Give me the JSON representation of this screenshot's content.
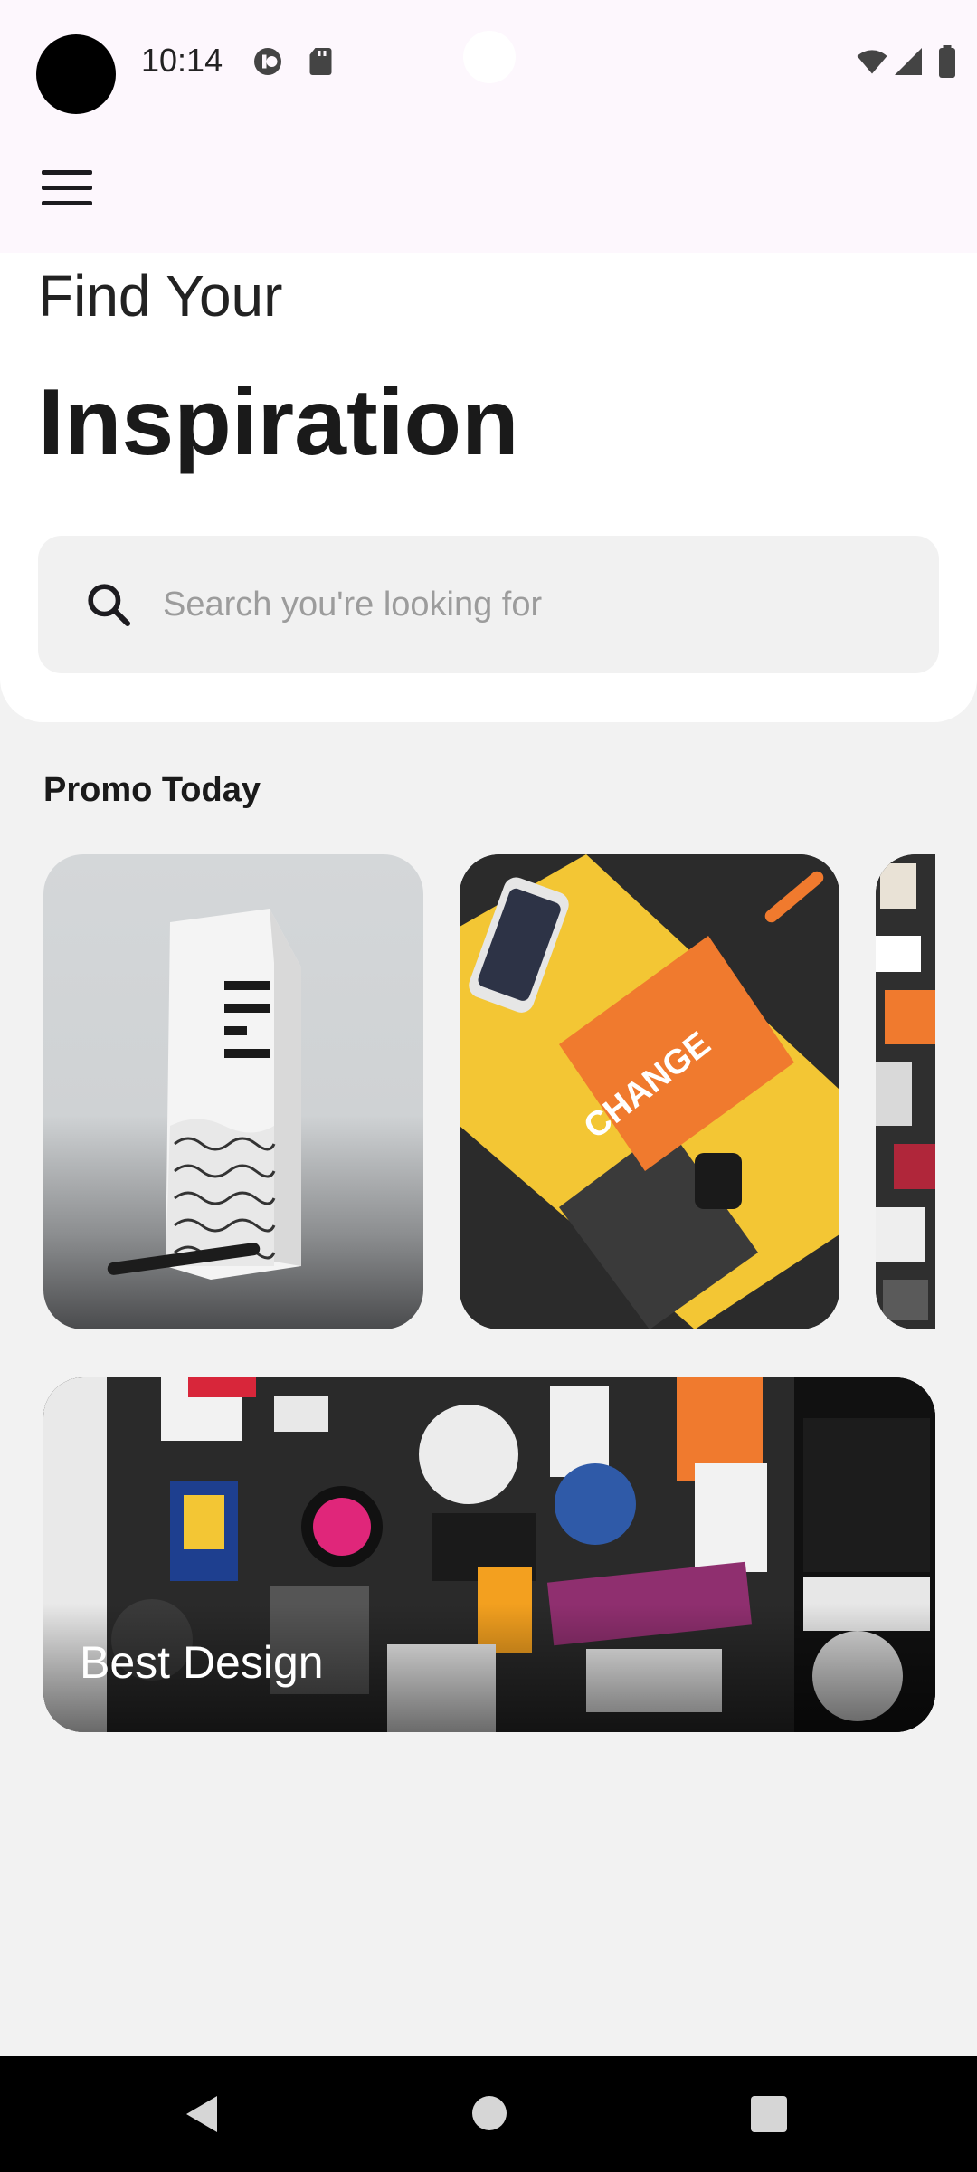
{
  "status_bar": {
    "time": "10:14"
  },
  "header": {
    "line1": "Find Your",
    "line2": "Inspiration"
  },
  "search": {
    "placeholder": "Search you're looking for"
  },
  "promo": {
    "section_title": "Promo Today",
    "cards": [
      {
        "image": "boxed-water-carton"
      },
      {
        "image": "change-by-design-book"
      },
      {
        "image": "sticker-wall"
      }
    ]
  },
  "featured": {
    "label": "Best Design"
  },
  "colors": {
    "header_bg": "#fdf7fd",
    "page_bg": "#f2f2f2",
    "search_bg": "#f1f1f1",
    "accent_orange": "#f07a2e",
    "accent_yellow": "#f3c634"
  }
}
